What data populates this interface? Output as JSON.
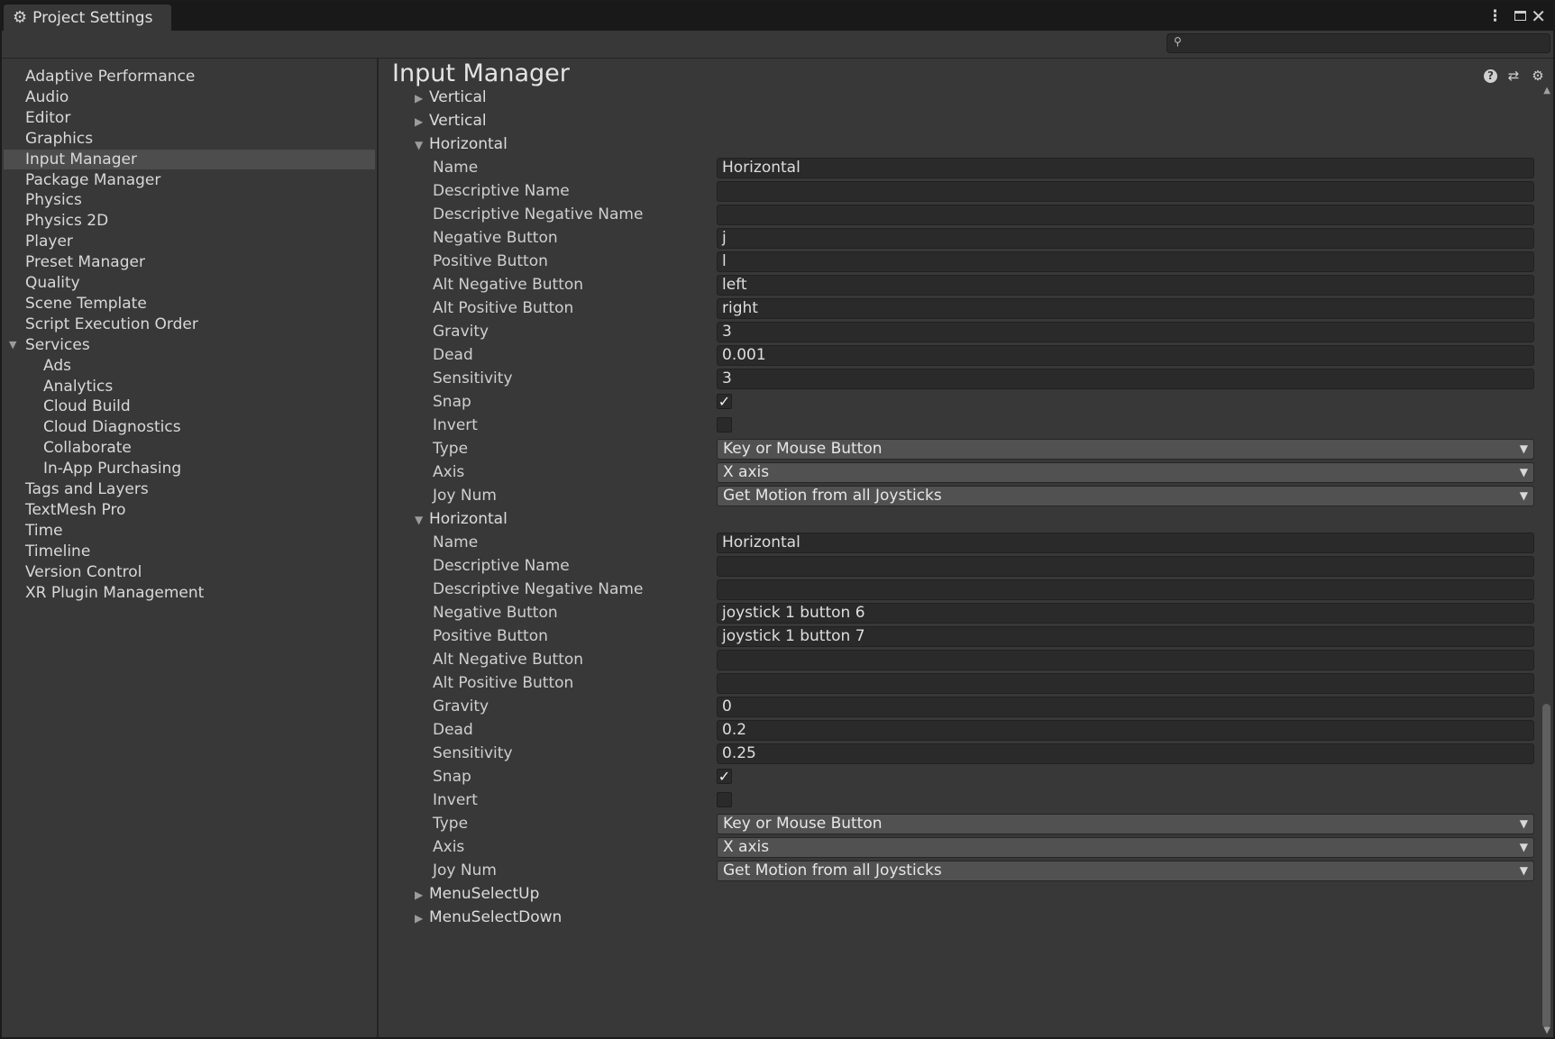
{
  "window": {
    "tab_title": "Project Settings",
    "tab_icon": "gear-icon",
    "search": {
      "placeholder": "",
      "value": ""
    }
  },
  "sidebar": {
    "items": [
      {
        "label": "Adaptive Performance",
        "level": 0,
        "selected": false
      },
      {
        "label": "Audio",
        "level": 0,
        "selected": false
      },
      {
        "label": "Editor",
        "level": 0,
        "selected": false
      },
      {
        "label": "Graphics",
        "level": 0,
        "selected": false
      },
      {
        "label": "Input Manager",
        "level": 0,
        "selected": true
      },
      {
        "label": "Package Manager",
        "level": 0,
        "selected": false
      },
      {
        "label": "Physics",
        "level": 0,
        "selected": false
      },
      {
        "label": "Physics 2D",
        "level": 0,
        "selected": false
      },
      {
        "label": "Player",
        "level": 0,
        "selected": false
      },
      {
        "label": "Preset Manager",
        "level": 0,
        "selected": false
      },
      {
        "label": "Quality",
        "level": 0,
        "selected": false
      },
      {
        "label": "Scene Template",
        "level": 0,
        "selected": false
      },
      {
        "label": "Script Execution Order",
        "level": 0,
        "selected": false
      },
      {
        "label": "Services",
        "level": 0,
        "selected": false,
        "expanded": true
      },
      {
        "label": "Ads",
        "level": 1,
        "selected": false
      },
      {
        "label": "Analytics",
        "level": 1,
        "selected": false
      },
      {
        "label": "Cloud Build",
        "level": 1,
        "selected": false
      },
      {
        "label": "Cloud Diagnostics",
        "level": 1,
        "selected": false
      },
      {
        "label": "Collaborate",
        "level": 1,
        "selected": false
      },
      {
        "label": "In-App Purchasing",
        "level": 1,
        "selected": false
      },
      {
        "label": "Tags and Layers",
        "level": 0,
        "selected": false
      },
      {
        "label": "TextMesh Pro",
        "level": 0,
        "selected": false
      },
      {
        "label": "Time",
        "level": 0,
        "selected": false
      },
      {
        "label": "Timeline",
        "level": 0,
        "selected": false
      },
      {
        "label": "Version Control",
        "level": 0,
        "selected": false
      },
      {
        "label": "XR Plugin Management",
        "level": 0,
        "selected": false
      }
    ]
  },
  "main": {
    "title": "Input Manager",
    "header_icons": [
      "help-icon",
      "preset-icon",
      "settings-icon"
    ],
    "rows": [
      {
        "kind": "fold",
        "label": "Vertical",
        "expanded": false
      },
      {
        "kind": "fold",
        "label": "Vertical",
        "expanded": false
      },
      {
        "kind": "fold",
        "label": "Horizontal",
        "expanded": true
      },
      {
        "kind": "text",
        "label": "Name",
        "value": "Horizontal"
      },
      {
        "kind": "text",
        "label": "Descriptive Name",
        "value": ""
      },
      {
        "kind": "text",
        "label": "Descriptive Negative Name",
        "value": ""
      },
      {
        "kind": "text",
        "label": "Negative Button",
        "value": "j"
      },
      {
        "kind": "text",
        "label": "Positive Button",
        "value": "l"
      },
      {
        "kind": "text",
        "label": "Alt Negative Button",
        "value": "left"
      },
      {
        "kind": "text",
        "label": "Alt Positive Button",
        "value": "right"
      },
      {
        "kind": "text",
        "label": "Gravity",
        "value": "3"
      },
      {
        "kind": "text",
        "label": "Dead",
        "value": "0.001"
      },
      {
        "kind": "text",
        "label": "Sensitivity",
        "value": "3"
      },
      {
        "kind": "check",
        "label": "Snap",
        "checked": true
      },
      {
        "kind": "check",
        "label": "Invert",
        "checked": false
      },
      {
        "kind": "select",
        "label": "Type",
        "value": "Key or Mouse Button"
      },
      {
        "kind": "select",
        "label": "Axis",
        "value": "X axis"
      },
      {
        "kind": "select",
        "label": "Joy Num",
        "value": "Get Motion from all Joysticks"
      },
      {
        "kind": "fold",
        "label": "Horizontal",
        "expanded": true
      },
      {
        "kind": "text",
        "label": "Name",
        "value": "Horizontal"
      },
      {
        "kind": "text",
        "label": "Descriptive Name",
        "value": ""
      },
      {
        "kind": "text",
        "label": "Descriptive Negative Name",
        "value": ""
      },
      {
        "kind": "text",
        "label": "Negative Button",
        "value": "joystick 1 button 6"
      },
      {
        "kind": "text",
        "label": "Positive Button",
        "value": "joystick 1 button 7"
      },
      {
        "kind": "text",
        "label": "Alt Negative Button",
        "value": ""
      },
      {
        "kind": "text",
        "label": "Alt Positive Button",
        "value": ""
      },
      {
        "kind": "text",
        "label": "Gravity",
        "value": "0"
      },
      {
        "kind": "text",
        "label": "Dead",
        "value": "0.2"
      },
      {
        "kind": "text",
        "label": "Sensitivity",
        "value": "0.25"
      },
      {
        "kind": "check",
        "label": "Snap",
        "checked": true
      },
      {
        "kind": "check",
        "label": "Invert",
        "checked": false
      },
      {
        "kind": "select",
        "label": "Type",
        "value": "Key or Mouse Button"
      },
      {
        "kind": "select",
        "label": "Axis",
        "value": "X axis"
      },
      {
        "kind": "select",
        "label": "Joy Num",
        "value": "Get Motion from all Joysticks"
      },
      {
        "kind": "fold",
        "label": "MenuSelectUp",
        "expanded": false
      },
      {
        "kind": "fold",
        "label": "MenuSelectDown",
        "expanded": false
      }
    ]
  }
}
